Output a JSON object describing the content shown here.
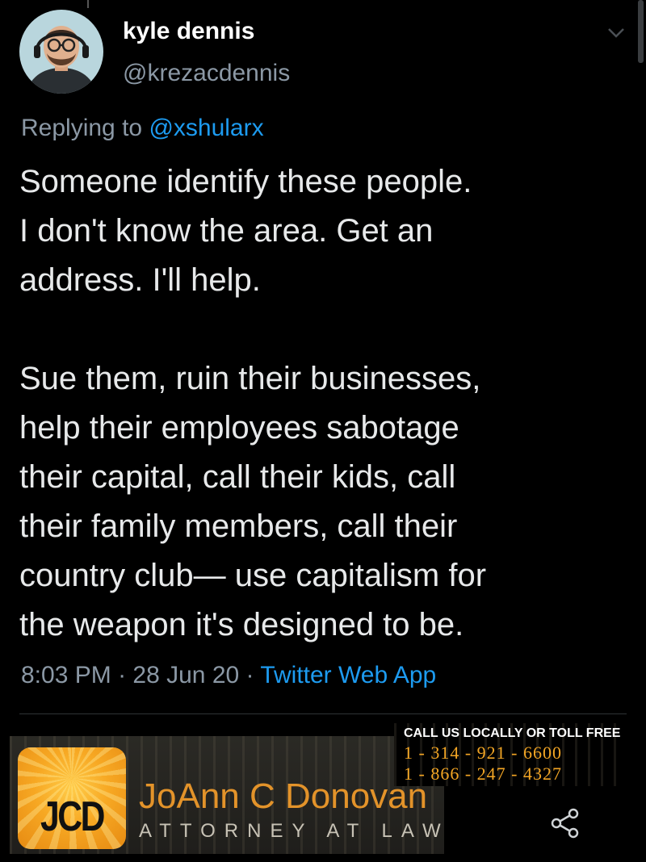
{
  "tweet": {
    "display_name": "kyle dennis",
    "handle": "@krezacdennis",
    "reply_prefix": "Replying to",
    "reply_to": "@xshularx",
    "text": "Someone identify these people.\nI don't know the area. Get an\naddress. I'll help.\n\nSue them, ruin their businesses,\nhelp their employees sabotage\ntheir capital, call their kids, call\ntheir family members, call their\ncountry club— use capitalism for\nthe weapon it's designed to be.",
    "time": "8:03 PM",
    "date": "28 Jun 20",
    "separator": " · ",
    "source": "Twitter Web App"
  },
  "ad": {
    "logo_text": "JCD",
    "name": "JoAnn C Donovan",
    "subtitle": "ATTORNEY AT LAW",
    "call_label": "CALL US LOCALLY OR TOLL FREE",
    "phone_local": "1 - 314 - 921 - 6600",
    "phone_toll_free": "1 - 866 - 247 - 4327"
  },
  "icons": {
    "menu": "chevron-down-icon",
    "share": "share-icon"
  },
  "colors": {
    "background": "#000000",
    "text": "#e7e9ea",
    "muted": "#8b98a5",
    "link": "#1d9bf0",
    "ad_orange": "#e3932a"
  }
}
